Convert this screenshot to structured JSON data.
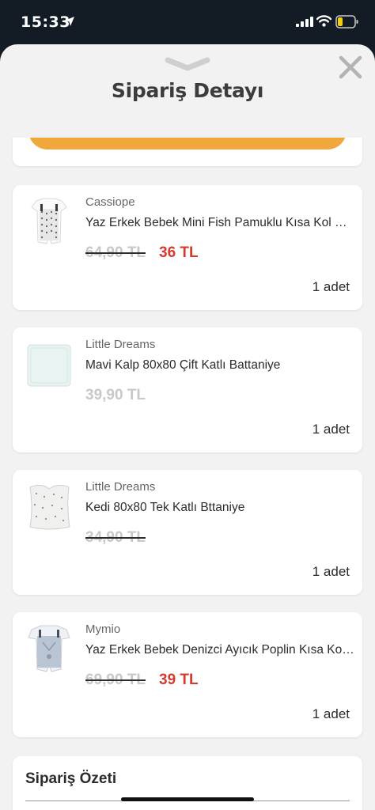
{
  "status_bar": {
    "time": "15:33"
  },
  "sheet": {
    "title": "Sipariş Detayı"
  },
  "products": [
    {
      "brand": "Cassiope",
      "name": "Yaz Erkek Bebek Mini Fish Pamuklu Kısa Kol Patiksiz Tulum",
      "old_price": "64,90 TL",
      "new_price": "36 TL",
      "quantity": "1 adet"
    },
    {
      "brand": "Little Dreams",
      "name": "Mavi Kalp 80x80 Çift Katlı Battaniye",
      "price": "39,90 TL",
      "quantity": "1 adet"
    },
    {
      "brand": "Little Dreams",
      "name": "Kedi 80x80 Tek Katlı Bttaniye",
      "old_price": "34,90 TL",
      "quantity": "1 adet"
    },
    {
      "brand": "Mymio",
      "name": "Yaz Erkek Bebek Denizci Ayıcık Poplin Kısa Kollu Tulum",
      "old_price": "69,90 TL",
      "new_price": "39 TL",
      "quantity": "1 adet"
    }
  ],
  "summary": {
    "title": "Sipariş Özeti"
  },
  "colors": {
    "accent": "#f0a83c",
    "discount_price": "#d63a2f",
    "status_bar_bg": "#131b24",
    "sheet_bg": "#f2f2f2"
  }
}
